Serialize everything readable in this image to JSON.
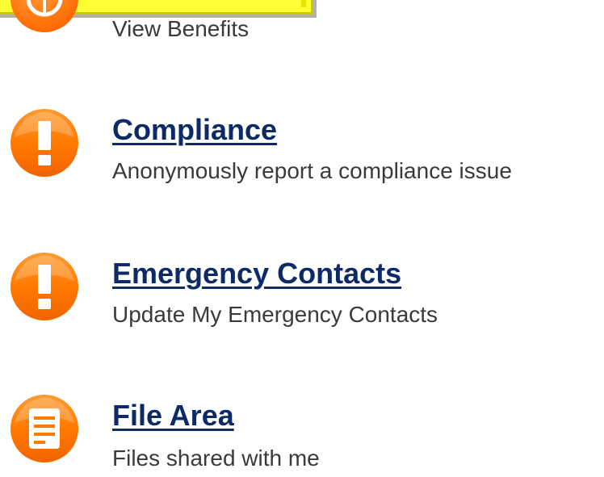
{
  "colors": {
    "icon_orange": "#ff7a00",
    "link_blue": "#0b2a66",
    "desc_gray": "#3a3a3a",
    "tooltip_yellow": "#ffff33"
  },
  "items": [
    {
      "icon": "globe-icon",
      "title": "",
      "description": "View Benefits"
    },
    {
      "icon": "exclamation-icon",
      "title": "Compliance",
      "description": "Anonymously report a compliance issue"
    },
    {
      "icon": "exclamation-icon",
      "title": "Emergency Contacts",
      "description": "Update My Emergency Contacts"
    },
    {
      "icon": "document-icon",
      "title": "File Area",
      "description": "Files shared with me"
    }
  ]
}
